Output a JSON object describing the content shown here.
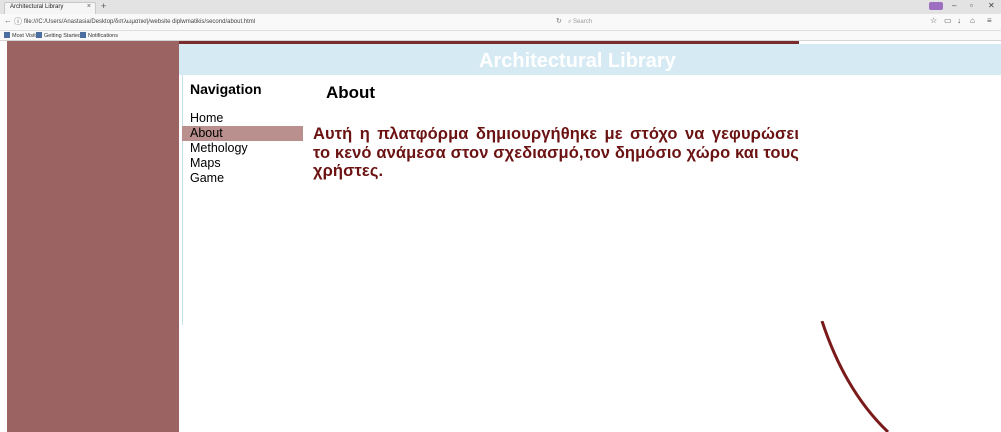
{
  "browser": {
    "tab_title": "Architectural Library",
    "tab_close": "×",
    "new_tab": "+",
    "url": "file:///C:/Users/Anastasia/Desktop/διπλωματική/website diplwmatikis/second/about.html",
    "search_placeholder": "Search",
    "bookmarks": [
      "Most Visited",
      "Getting Started",
      "Notifications"
    ]
  },
  "site": {
    "title": "Architectural Library"
  },
  "nav": {
    "heading": "Navigation",
    "items": [
      {
        "label": "Home"
      },
      {
        "label": "About"
      },
      {
        "label": "Methology"
      },
      {
        "label": "Maps"
      },
      {
        "label": "Game"
      }
    ],
    "active_index": 1
  },
  "content": {
    "title": "About",
    "text": "Αυτή η πλατφόρμα δημιουργήθηκε με στόχο να γεφυρώσει το κενό ανάμεσα στον σχεδιασμό,τον δημόσιο χώρο και τους χρήστες."
  },
  "colors": {
    "sidebar": "#9c6363",
    "header": "#d6eaf4",
    "active_nav": "#b9908e",
    "text_accent": "#6b1212"
  }
}
